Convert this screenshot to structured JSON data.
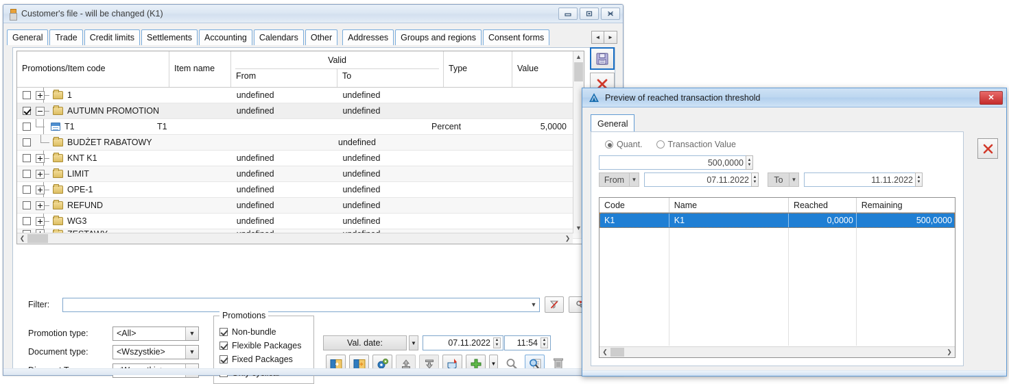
{
  "main_window": {
    "title": "Customer's file - will be changed (K1)",
    "icon": "lipstick-icon",
    "window_buttons": {
      "minimize": "minimize-icon",
      "maximize": "maximize-icon",
      "close": "close-icon"
    },
    "tabs": [
      {
        "label": "General"
      },
      {
        "label": "Trade"
      },
      {
        "label": "Credit limits"
      },
      {
        "label": "Settlements"
      },
      {
        "label": "Accounting"
      },
      {
        "label": "Calendars"
      },
      {
        "label": "Other"
      },
      {
        "label": "Addresses"
      },
      {
        "label": "Groups and regions"
      },
      {
        "label": "Consent forms"
      }
    ],
    "tab_nav": {
      "prev": "◄",
      "next": "►"
    }
  },
  "tree": {
    "columns": {
      "promotions": "Promotions/Item code",
      "item_name": "Item name",
      "valid": "Valid",
      "valid_from": "From",
      "valid_to": "To",
      "type": "Type",
      "value": "Value"
    },
    "rows": [
      {
        "checked": false,
        "expander": "plus",
        "level": 0,
        "icon": "folder-icon",
        "name": "1",
        "item_name": "",
        "from": "undefined",
        "to": "undefined",
        "type": "",
        "value": ""
      },
      {
        "checked": true,
        "expander": "minus",
        "level": 0,
        "icon": "folder-icon",
        "name": "AUTUMN PROMOTION",
        "item_name": "",
        "from": "undefined",
        "to": "undefined",
        "type": "",
        "value": ""
      },
      {
        "checked": false,
        "expander": "none",
        "level": 1,
        "icon": "document-icon",
        "name": "T1",
        "item_name": "T1",
        "from": "",
        "to": "",
        "type": "Percent",
        "value": "5,0000"
      },
      {
        "checked": false,
        "expander": "none",
        "level": 0,
        "icon": "folder-icon",
        "name": "BUDŻET RABATOWY",
        "item_name": "",
        "from": "",
        "to": "undefined",
        "type": "",
        "value": ""
      },
      {
        "checked": false,
        "expander": "plus",
        "level": 0,
        "icon": "folder-icon",
        "name": "KNT K1",
        "item_name": "",
        "from": "undefined",
        "to": "undefined",
        "type": "",
        "value": ""
      },
      {
        "checked": false,
        "expander": "plus",
        "level": 0,
        "icon": "folder-icon",
        "name": "LIMIT",
        "item_name": "",
        "from": "undefined",
        "to": "undefined",
        "type": "",
        "value": ""
      },
      {
        "checked": false,
        "expander": "plus",
        "level": 0,
        "icon": "folder-icon",
        "name": "OPE-1",
        "item_name": "",
        "from": "undefined",
        "to": "undefined",
        "type": "",
        "value": ""
      },
      {
        "checked": false,
        "expander": "plus",
        "level": 0,
        "icon": "folder-icon",
        "name": "REFUND",
        "item_name": "",
        "from": "undefined",
        "to": "undefined",
        "type": "",
        "value": ""
      },
      {
        "checked": false,
        "expander": "plus",
        "level": 0,
        "icon": "folder-icon",
        "name": "WG3",
        "item_name": "",
        "from": "undefined",
        "to": "undefined",
        "type": "",
        "value": ""
      },
      {
        "checked": false,
        "expander": "plus",
        "level": 0,
        "icon": "folder-icon",
        "name": "ZESTAWY",
        "item_name": "",
        "from": "undefined",
        "to": "undefined",
        "type": "",
        "value": ""
      }
    ]
  },
  "filter": {
    "label": "Filter:",
    "value": "",
    "placeholder": "",
    "dropdown_icon": "chevron-down-icon",
    "clear_filter_icon": "filter-clear-icon",
    "filter_builder_icon": "filter-wrench-icon"
  },
  "form": {
    "promotion_type": {
      "label": "Promotion type:",
      "value": "<All>"
    },
    "document_type": {
      "label": "Document type:",
      "value": "<Wszystkie>"
    },
    "discount_type": {
      "label": "Discount Type:",
      "value": "<Wszystkie>"
    }
  },
  "promotions_group": {
    "title": "Promotions",
    "items": [
      {
        "label": "Non-bundle",
        "checked": true
      },
      {
        "label": "Flexible Packages",
        "checked": true
      },
      {
        "label": "Fixed Packages",
        "checked": true
      },
      {
        "label": "Only cyclical",
        "checked": false
      }
    ]
  },
  "val_date": {
    "label": "Val. date:",
    "date": "07.11.2022",
    "time": "11:54"
  },
  "toolbar_icons": [
    {
      "name": "import-left-icon"
    },
    {
      "name": "export-right-icon"
    },
    {
      "name": "settings-gear-icon"
    },
    {
      "name": "upload-icon"
    },
    {
      "name": "download-icon"
    },
    {
      "name": "paint-bucket-icon"
    },
    {
      "name": "add-plus-icon"
    },
    {
      "name": "add-dropdown-icon"
    },
    {
      "name": "search-icon"
    },
    {
      "name": "search-details-icon"
    },
    {
      "name": "delete-trash-icon"
    }
  ],
  "side_strip": [
    {
      "name": "save-icon"
    },
    {
      "name": "cancel-x-icon"
    }
  ],
  "modal": {
    "title": "Preview of reached transaction threshold",
    "icon": "app-triangle-icon",
    "close_label": "✕",
    "tab": "General",
    "mode": {
      "quant": {
        "label": "Quant.",
        "selected": true
      },
      "transaction_value": {
        "label": "Transaction Value",
        "selected": false
      }
    },
    "amount": "500,0000",
    "from": {
      "label": "From",
      "value": "07.11.2022"
    },
    "to": {
      "label": "To",
      "value": "11.11.2022"
    },
    "close_panel_icon": "cancel-x-icon",
    "grid": {
      "columns": [
        "Code",
        "Name",
        "Reached",
        "Remaining"
      ],
      "rows": [
        {
          "code": "K1",
          "name": "K1",
          "reached": "0,0000",
          "remaining": "500,0000",
          "selected": true
        }
      ]
    }
  }
}
